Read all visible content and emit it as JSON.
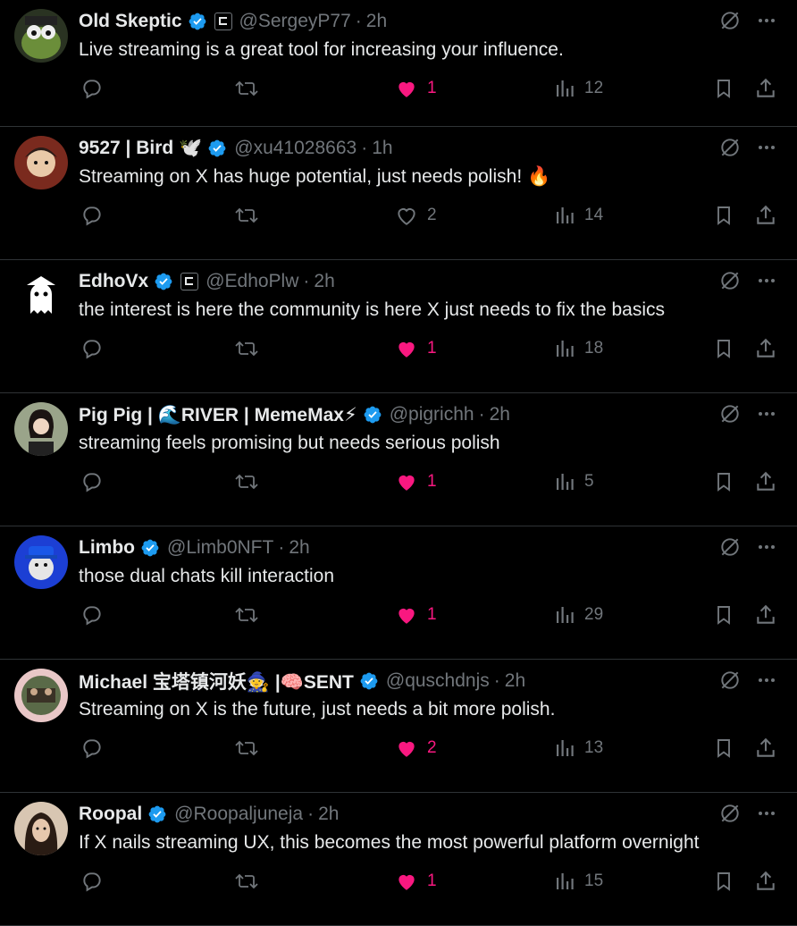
{
  "tweets": [
    {
      "name": "Old Skeptic",
      "handle": "@SergeyP77",
      "time": "2h",
      "text": "Live streaming is a great tool for increasing your influence.",
      "likes": "1",
      "liked": true,
      "views": "12",
      "replies": "",
      "reposts": "",
      "emoji": "",
      "affiliation": true
    },
    {
      "name": "9527 | Bird 🕊️",
      "handle": "@xu41028663",
      "time": "1h",
      "text": "Streaming on X has huge potential, just needs polish! 🔥",
      "likes": "2",
      "liked": false,
      "views": "14",
      "replies": "",
      "reposts": "",
      "emoji": "",
      "affiliation": false
    },
    {
      "name": "EdhoVx",
      "handle": "@EdhoPlw",
      "time": "2h",
      "text": "the interest is here the community is here X just needs to fix the basics",
      "likes": "1",
      "liked": true,
      "views": "18",
      "replies": "",
      "reposts": "",
      "emoji": "",
      "affiliation": true
    },
    {
      "name": "Pig Pig | 🌊RIVER | MemeMax⚡",
      "handle": "@pigrichh",
      "time": "2h",
      "text": "streaming feels promising but needs serious polish",
      "likes": "1",
      "liked": true,
      "views": "5",
      "replies": "",
      "reposts": "",
      "emoji": "",
      "affiliation": false
    },
    {
      "name": "Limbo",
      "handle": "@Limb0NFT",
      "time": "2h",
      "text": "those dual chats kill interaction",
      "likes": "1",
      "liked": true,
      "views": "29",
      "replies": "",
      "reposts": "",
      "emoji": "",
      "affiliation": false
    },
    {
      "name": "Michael 宝塔镇河妖🧙 |🧠SENT",
      "handle": "@quschdnjs",
      "time": "2h",
      "text": "Streaming on X is the future, just needs a bit more polish.",
      "likes": "2",
      "liked": true,
      "views": "13",
      "replies": "",
      "reposts": "",
      "emoji": "",
      "affiliation": false
    },
    {
      "name": "Roopal",
      "handle": "@Roopaljuneja",
      "time": "2h",
      "text": "If X nails streaming UX, this becomes the most powerful platform overnight",
      "likes": "1",
      "liked": true,
      "views": "15",
      "replies": "",
      "reposts": "",
      "emoji": "",
      "affiliation": false
    }
  ],
  "colors": {
    "background": "#000000",
    "text": "#e7e9ea",
    "muted": "#71767b",
    "like": "#f91880",
    "verified": "#1d9bf0",
    "divider": "#2f3336"
  },
  "icons": {
    "reply": "reply-icon",
    "repost": "repost-icon",
    "like": "heart-icon",
    "views": "views-icon",
    "bookmark": "bookmark-icon",
    "share": "share-icon",
    "grok": "grok-icon",
    "more": "more-icon",
    "verified": "verified-badge-icon"
  },
  "avatars": [
    "frog-avatar",
    "illustrated-character-avatar",
    "ghost-avatar",
    "woman-photo-avatar",
    "blue-ape-avatar",
    "group-photo-avatar",
    "woman-portrait-avatar"
  ]
}
